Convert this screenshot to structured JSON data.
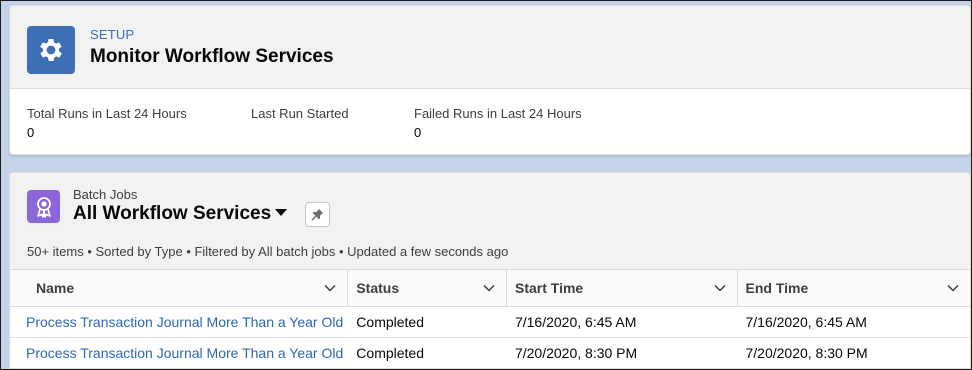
{
  "header": {
    "breadcrumb": "SETUP",
    "title": "Monitor Workflow Services",
    "stats": [
      {
        "label": "Total Runs in Last 24 Hours",
        "value": "0"
      },
      {
        "label": "Last Run Started",
        "value": ""
      },
      {
        "label": "Failed Runs in Last 24 Hours",
        "value": "0"
      }
    ]
  },
  "list": {
    "object_label": "Batch Jobs",
    "view_name": "All Workflow Services",
    "meta": "50+ items • Sorted by Type • Filtered by All batch jobs • Updated a few seconds ago",
    "columns": [
      "Name",
      "Status",
      "Start Time",
      "End Time"
    ],
    "rows": [
      {
        "name": "Process Transaction Journal More Than a Year Old",
        "status": "Completed",
        "start": "7/16/2020, 6:45 AM",
        "end": "7/16/2020, 6:45 AM"
      },
      {
        "name": "Process Transaction Journal More Than a Year Old",
        "status": "Completed",
        "start": "7/20/2020, 8:30 PM",
        "end": "7/20/2020, 8:30 PM"
      }
    ]
  },
  "colors": {
    "setup_icon_bg": "#3c6fb3",
    "object_icon_bg": "#8b66d8",
    "link": "#2c68b2"
  },
  "icons": {
    "setup": "gear-icon",
    "object": "award-ribbon-icon",
    "pin": "pin-icon",
    "column_menu": "chevron-down-icon"
  }
}
